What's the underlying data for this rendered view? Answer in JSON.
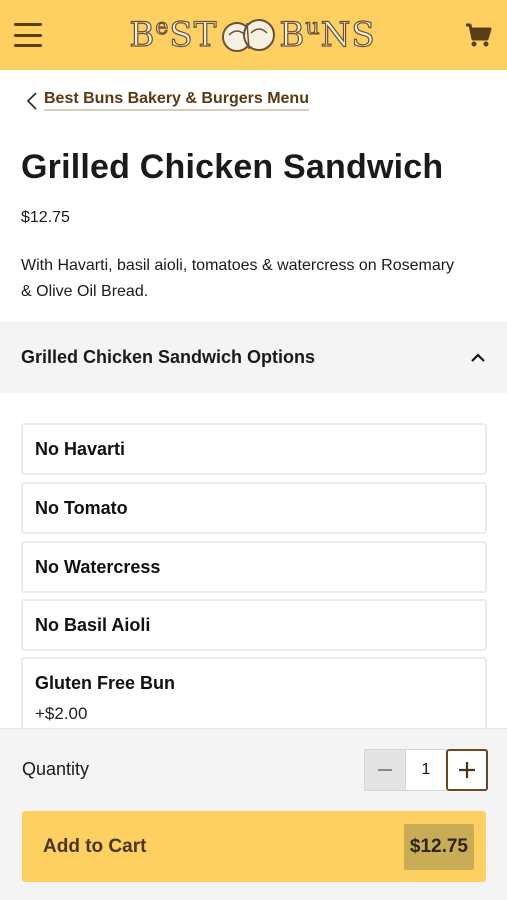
{
  "header": {
    "logo_text_left": "B",
    "logo_text_left_small": "e",
    "logo_text_left2": "ST",
    "logo_text_right": "B",
    "logo_text_right_small": "u",
    "logo_text_right2": "NS",
    "colors": {
      "bar": "#fed061",
      "accent": "#5a3e18"
    }
  },
  "breadcrumb": {
    "label": "Best Buns Bakery & Burgers Menu"
  },
  "item": {
    "title": "Grilled Chicken Sandwich",
    "price": "$12.75",
    "description": "With Havarti, basil aioli, tomatoes & watercress on Rosemary & Olive Oil Bread."
  },
  "options": {
    "header": "Grilled Chicken Sandwich Options",
    "expanded": true,
    "items": [
      {
        "label": "No Havarti"
      },
      {
        "label": "No Tomato"
      },
      {
        "label": "No Watercress"
      },
      {
        "label": "No Basil Aioli"
      },
      {
        "label": "Gluten Free Bun",
        "extra": "+$2.00"
      }
    ]
  },
  "cart": {
    "quantity_label": "Quantity",
    "quantity": "1",
    "add_label": "Add to Cart",
    "total": "$12.75"
  }
}
